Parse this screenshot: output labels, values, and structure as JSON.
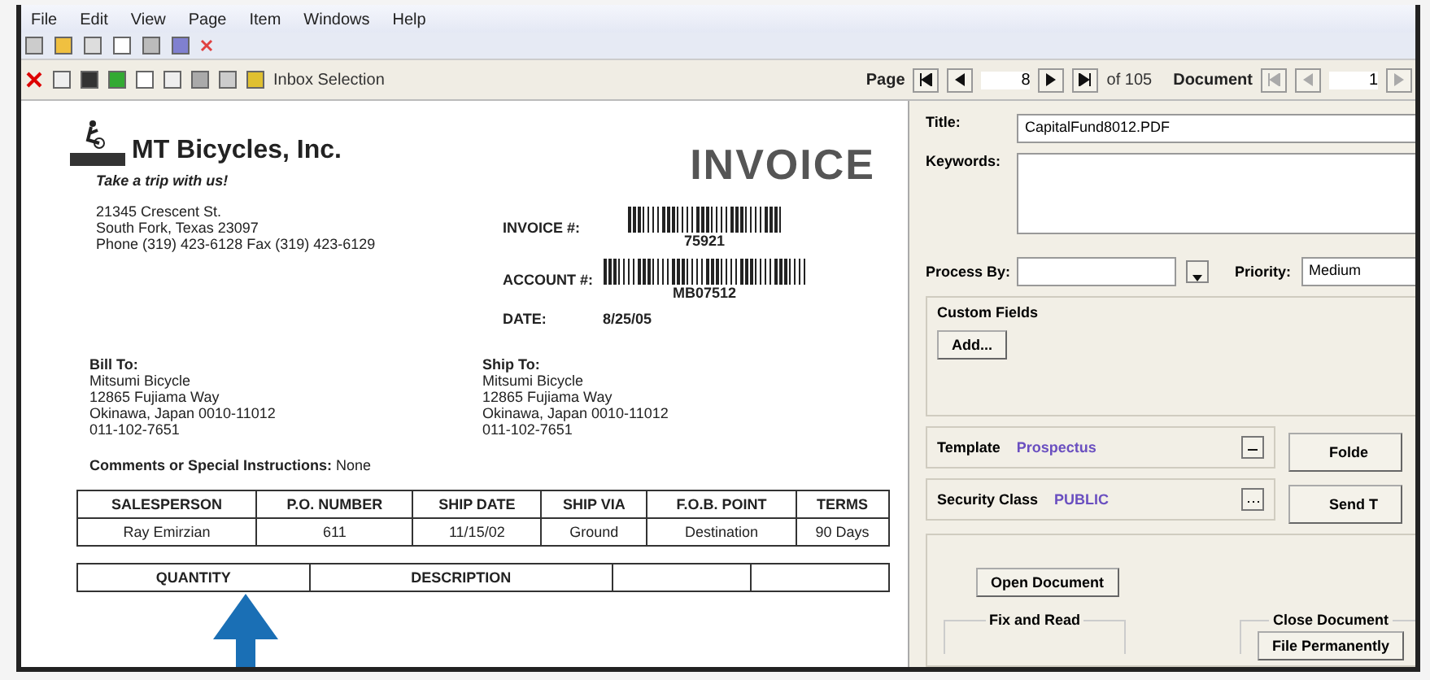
{
  "menu": [
    "File",
    "Edit",
    "View",
    "Page",
    "Item",
    "Windows",
    "Help"
  ],
  "toolbar": {
    "label": "Inbox Selection"
  },
  "page_nav": {
    "label": "Page",
    "value": "8",
    "total": "of 105"
  },
  "document_nav": {
    "label": "Document",
    "value": "1"
  },
  "invoice": {
    "company": "MT Bicycles, Inc.",
    "tagline": "Take a trip with us!",
    "title": "INVOICE",
    "address": [
      "21345 Crescent St.",
      "South Fork, Texas 23097",
      "Phone (319) 423-6128  Fax (319) 423-6129"
    ],
    "invoice_label": "INVOICE #:",
    "invoice_number": "75921",
    "account_label": "ACCOUNT #:",
    "account_number": "MB07512",
    "date_label": "DATE:",
    "date": "8/25/05",
    "bill_to": {
      "heading": "Bill To:",
      "lines": [
        "Mitsumi Bicycle",
        "12865 Fujiama Way",
        "Okinawa, Japan 0010-11012",
        "011-102-7651"
      ]
    },
    "ship_to": {
      "heading": "Ship To:",
      "lines": [
        "Mitsumi Bicycle",
        "12865 Fujiama Way",
        "Okinawa, Japan 0010-11012",
        "011-102-7651"
      ]
    },
    "comments": "**Comments or Special Instructions:** None",
    "order_table": {
      "columns": [
        "SALESPERSON",
        "P.O. NUMBER",
        "SHIP DATE",
        "SHIP VIA",
        "F.O.B. POINT",
        "TERMS"
      ],
      "rows": [
        [
          "Ray Emirzian",
          "611",
          "11/15/02",
          "Ground",
          "Destination",
          "90 Days"
        ]
      ]
    },
    "items_table": {
      "columns": [
        "QUANTITY",
        "DESCRIPTION"
      ]
    }
  },
  "properties": {
    "title_label": "Title:",
    "title_value": "CapitalFund8012.PDF",
    "keywords_label": "Keywords:",
    "process_by_label": "Process By:",
    "priority_label": "Priority:",
    "priority_value": "Medium",
    "custom_fields": {
      "heading": "Custom Fields",
      "button": "Add..."
    },
    "template": {
      "label": "Template",
      "value": "Prospectus"
    },
    "security": {
      "label": "Security Class",
      "value": "PUBLIC"
    },
    "side_buttons": [
      "Folde",
      "Send T"
    ],
    "open_button": "Open Document",
    "fix_group": "Fix and Read",
    "close_group": "Close Document",
    "file_button": "File Permanently"
  }
}
